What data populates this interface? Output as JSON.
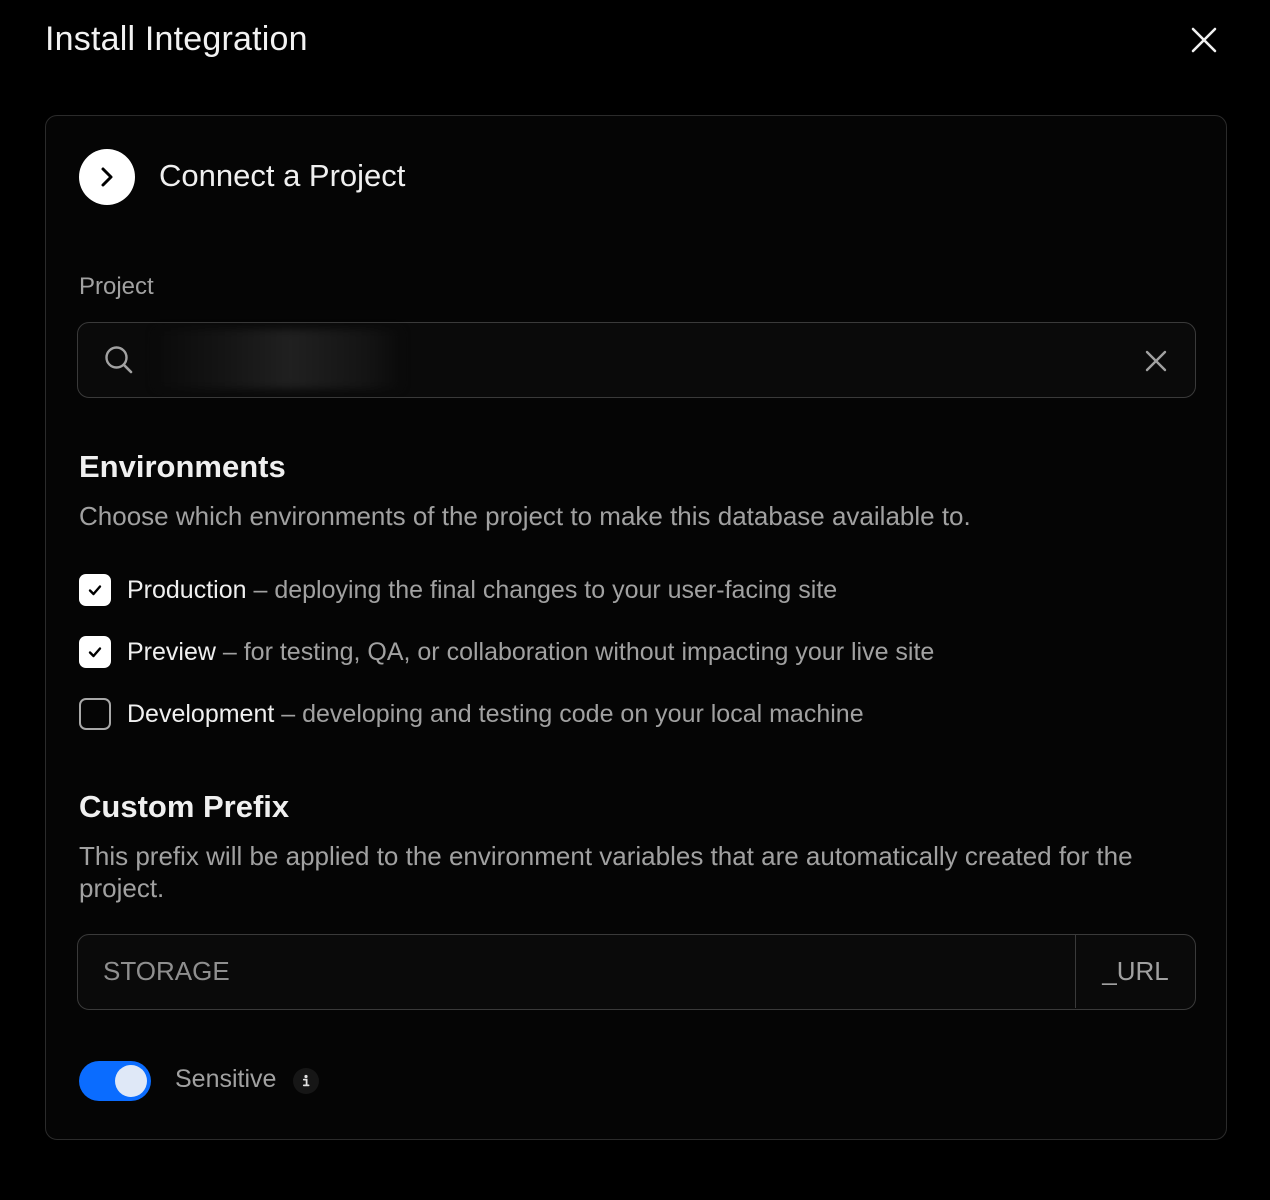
{
  "dialog": {
    "title": "Install Integration"
  },
  "step": {
    "title": "Connect a Project"
  },
  "project": {
    "label": "Project",
    "search_value": "",
    "search_value_redacted": true
  },
  "environments": {
    "title": "Environments",
    "description": "Choose which environments of the project to make this database available to.",
    "items": [
      {
        "name": "Production",
        "description": "– deploying the final changes to your user-facing site",
        "checked": true
      },
      {
        "name": "Preview",
        "description": "– for testing, QA, or collaboration without impacting your live site",
        "checked": true
      },
      {
        "name": "Development",
        "description": "– developing and testing code on your local machine",
        "checked": false
      }
    ]
  },
  "custom_prefix": {
    "title": "Custom Prefix",
    "description": "This prefix will be applied to the environment variables that are automatically created for the project.",
    "placeholder": "STORAGE",
    "value": "",
    "suffix": "_URL"
  },
  "sensitive": {
    "label": "Sensitive",
    "enabled": true
  },
  "colors": {
    "background": "#000000",
    "toggle_on": "#0a6cff",
    "text_primary": "#f0f0f0",
    "text_secondary": "#a1a1a1",
    "border": "#3a3a3a"
  },
  "icons": {
    "close": "close-icon",
    "step": "chevron-right-icon",
    "search": "search-icon",
    "clear": "clear-icon",
    "check": "check-icon",
    "info": "info-icon"
  }
}
